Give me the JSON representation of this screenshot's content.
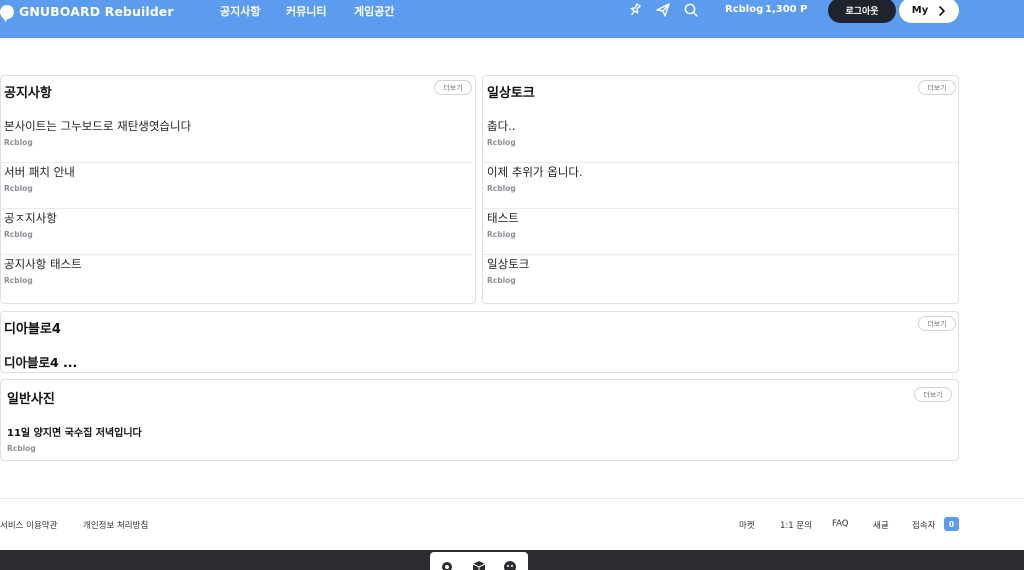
{
  "header": {
    "logo_text": "GNUBOARD Rebuilder",
    "nav": [
      "공지사항",
      "커뮤니티",
      "게임공간"
    ],
    "icons": [
      "pin-icon",
      "send-icon",
      "search-icon"
    ],
    "username": "Rcblog",
    "points": "1,300 P",
    "logout_label": "로그아웃",
    "my_label": "My",
    "brand_color": "#5b9bf0"
  },
  "boards": {
    "notice": {
      "title": "공지사항",
      "more": "더보기",
      "posts": [
        {
          "title": "본사이트는 그누보드로 재탄생엿습니다",
          "author": "Rcblog"
        },
        {
          "title": "서버 패치 안내",
          "author": "Rcblog"
        },
        {
          "title": "공ㅈ지사항",
          "author": "Rcblog"
        },
        {
          "title": "공지사항 태스트",
          "author": "Rcblog"
        }
      ]
    },
    "daily": {
      "title": "일상토크",
      "more": "더보기",
      "posts": [
        {
          "title": "춥다..",
          "author": "Rcblog"
        },
        {
          "title": "이제 추위가 옵니다.",
          "author": "Rcblog"
        },
        {
          "title": "태스트",
          "author": "Rcblog"
        },
        {
          "title": "일상토크",
          "author": "Rcblog"
        }
      ]
    },
    "diablo": {
      "title": "디아블로4",
      "more": "더보기",
      "post_title": "디아블로4 ..."
    },
    "photo": {
      "title": "일반사진",
      "more": "더보기",
      "posts": [
        {
          "title": "11일 양지면 국수집 저녁입니다",
          "author": "Rcblog"
        }
      ]
    }
  },
  "footer": {
    "left_links": [
      "서비스 이용약관",
      "개인정보 처리방침"
    ],
    "right_links": [
      "마켓",
      "1:1 문의",
      "FAQ",
      "새글",
      "접속자"
    ],
    "visitor_count": "0"
  }
}
